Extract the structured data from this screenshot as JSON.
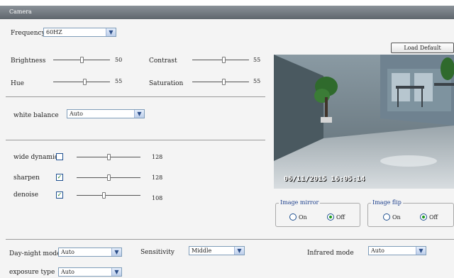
{
  "header": {
    "title": "Camera"
  },
  "frequency": {
    "label": "Frequency",
    "value": "60HZ"
  },
  "buttons": {
    "load_default": "Load Default"
  },
  "sliders": {
    "brightness": {
      "label": "Brightness",
      "value": "50",
      "fraction": 0.5
    },
    "contrast": {
      "label": "Contrast",
      "value": "55",
      "fraction": 0.55
    },
    "hue": {
      "label": "Hue",
      "value": "55",
      "fraction": 0.55
    },
    "saturation": {
      "label": "Saturation",
      "value": "55",
      "fraction": 0.55
    }
  },
  "white_balance": {
    "label": "white balance",
    "value": "Auto"
  },
  "wide_dynamic": {
    "label": "wide dynamic",
    "checked": false,
    "value": "128",
    "fraction": 0.5
  },
  "sharpen": {
    "label": "sharpen",
    "checked": true,
    "value": "128",
    "fraction": 0.5
  },
  "denoise": {
    "label": "denoise",
    "checked": true,
    "value": "108",
    "fraction": 0.42
  },
  "video": {
    "timestamp": "06/11/2015 16:05:14"
  },
  "image_mirror": {
    "title": "Image mirror",
    "on": "On",
    "off": "Off",
    "selected": "Off"
  },
  "image_flip": {
    "title": "Image flip",
    "on": "On",
    "off": "Off",
    "selected": "Off"
  },
  "day_night": {
    "label": "Day-night mode",
    "value": "Auto"
  },
  "sensitivity": {
    "label": "Sensitivity",
    "value": "Middle"
  },
  "infrared": {
    "label": "Infrared mode",
    "value": "Auto"
  },
  "exposure": {
    "label": "exposure type",
    "value": "Auto"
  },
  "icons": {
    "dropdown": "chevron-down-icon",
    "check": "checkmark-icon"
  }
}
